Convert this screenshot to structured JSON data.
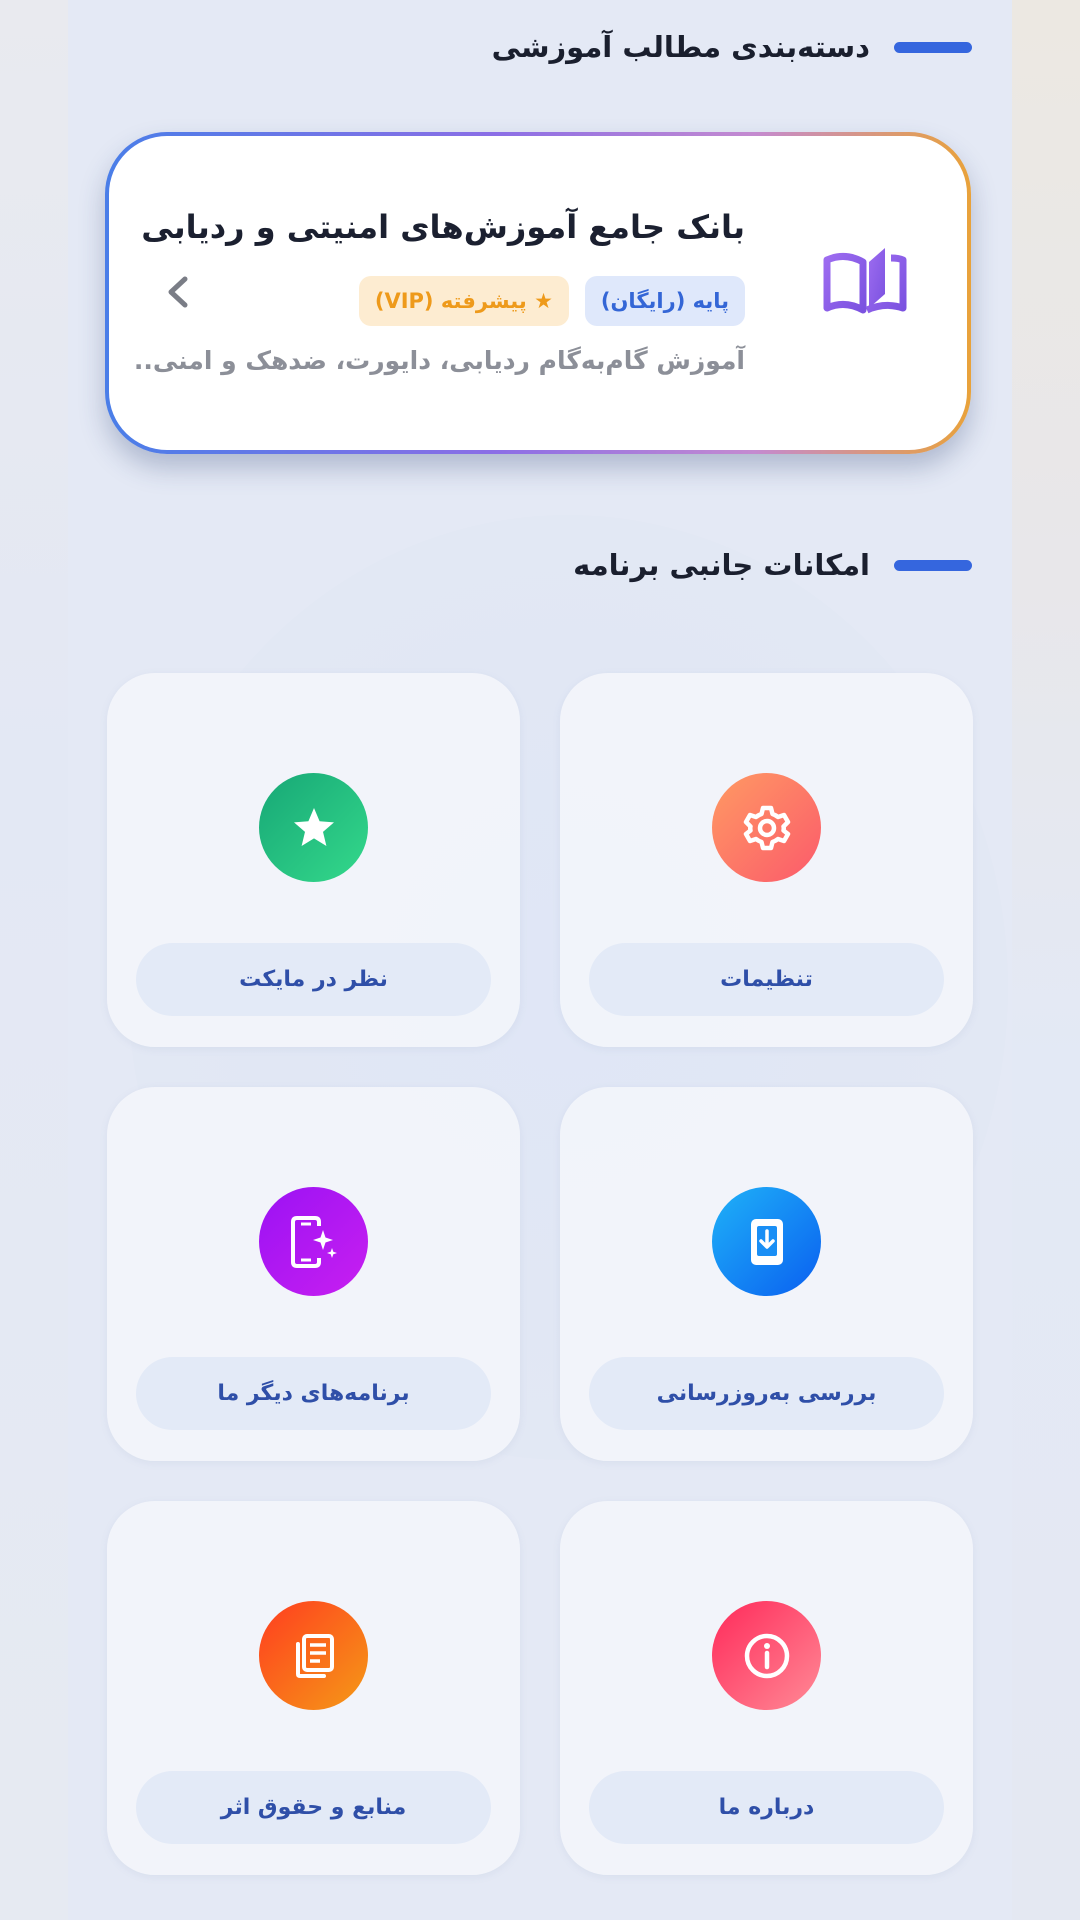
{
  "sections": {
    "education_title": "دسته‌بندی مطالب آموزشی",
    "features_title": "امکانات جانبی برنامه"
  },
  "banner": {
    "title": "بانک جامع آموزش‌های امنیتی و ردیابی",
    "badge_basic": "پایه (رایگان)",
    "badge_vip": "★ پیشرفته (VIP)",
    "description": "آموزش گام‌به‌گام ردیابی، دایورت، ضدهک و امنی..",
    "icon": "book-open-icon",
    "chevron_icon": "chevron-left-icon"
  },
  "features": [
    {
      "label": "تنظیمات",
      "icon": "gear-icon",
      "gradient": [
        "#ff9a63",
        "#fb5a6b"
      ]
    },
    {
      "label": "نظر در مایکت",
      "icon": "star-icon",
      "gradient": [
        "#17a776",
        "#34d98b"
      ]
    },
    {
      "label": "بررسی به‌روزرسانی",
      "icon": "phone-download-icon",
      "gradient": [
        "#1a9af6",
        "#0a67f2"
      ]
    },
    {
      "label": "برنامه‌های دیگر ما",
      "icon": "phone-sparkle-icon",
      "gradient": [
        "#a514f5",
        "#c31bf2"
      ]
    },
    {
      "label": "درباره ما",
      "icon": "info-icon",
      "gradient": [
        "#ff2f5e",
        "#ff7a8c"
      ]
    },
    {
      "label": "منابع و حقوق اثر",
      "icon": "document-icon",
      "gradient": [
        "#ff4a1c",
        "#f58f17"
      ]
    }
  ],
  "colors": {
    "accent": "#3566de",
    "label_text": "#2f4fa8"
  }
}
